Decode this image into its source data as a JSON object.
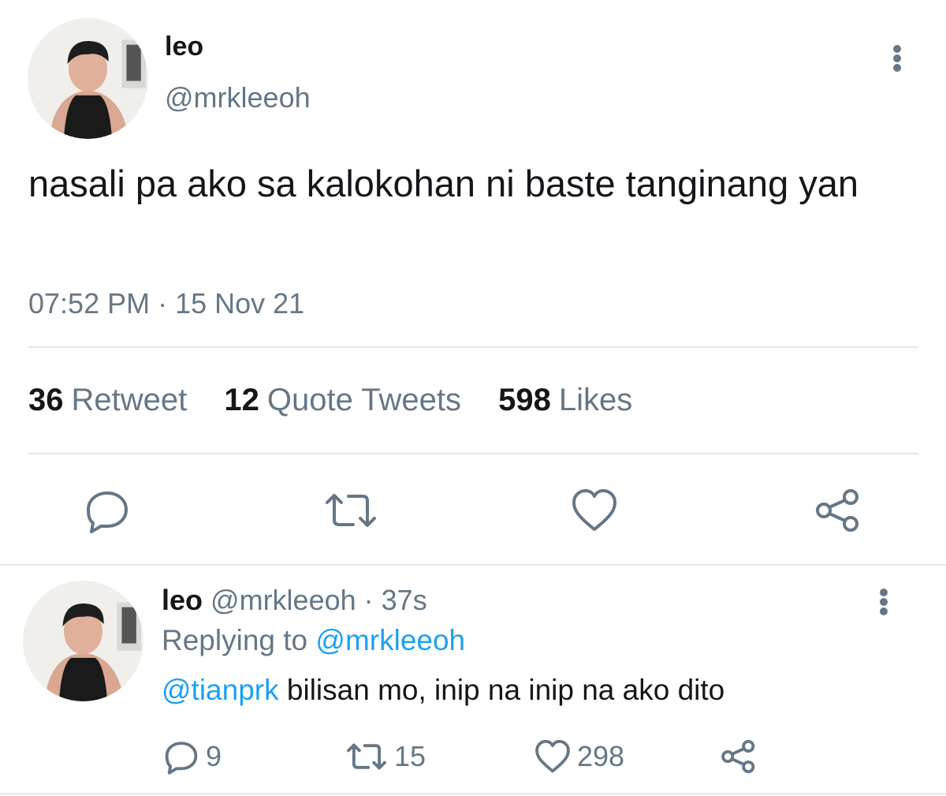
{
  "main_tweet": {
    "name": "leo",
    "handle": "@mrkleeoh",
    "text": "nasali pa ako sa kalokohan ni baste tanginang yan",
    "timestamp": "07:52 PM · 15 Nov 21",
    "stats": {
      "retweets_count": "36",
      "retweets_label": "Retweet",
      "quotes_count": "12",
      "quotes_label": "Quote Tweets",
      "likes_count": "598",
      "likes_label": "Likes"
    }
  },
  "reply_tweet": {
    "name": "leo",
    "handle": "@mrkleeoh",
    "age": "· 37s",
    "replying_prefix": "Replying to",
    "replying_to": "@mrkleeoh",
    "mention": "@tianprk",
    "text": "bilisan mo, inip na inip na ako dito",
    "reply_count": "9",
    "retweet_count": "15",
    "like_count": "298"
  },
  "colors": {
    "text": "#14171a",
    "secondary": "#657786",
    "link": "#1da1f2",
    "divider": "#e1e8ed"
  },
  "icons": [
    "reply-icon",
    "retweet-icon",
    "heart-icon",
    "share-icon",
    "more-icon"
  ]
}
